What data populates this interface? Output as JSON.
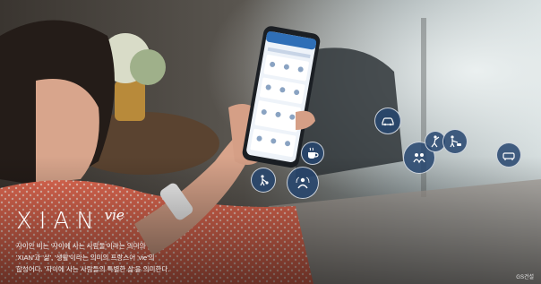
{
  "brand": {
    "logo_main": "XIAN",
    "logo_sub": "vie",
    "description_lines": [
      "자이안 비는 '자이에 사는 사람들'이라는 의미의",
      "'XIAN'과 '삶', '생활'이라는 의미의 프랑스어 'vie'의",
      "합성어다. '자이에 사는 사람들의 특별한 삶'을 의미한다."
    ]
  },
  "watermark": "GS건설",
  "icons": [
    "car-icon",
    "family-icon",
    "cafe-icon",
    "meeting-icon",
    "golf-icon",
    "pet-icon",
    "sofa-icon",
    "dog-walk-icon"
  ],
  "colors": {
    "badge": "#26456e",
    "phone_screen": "#eef3f9",
    "phone_header": "#2f6fb7",
    "dress": "#e56a4f"
  }
}
